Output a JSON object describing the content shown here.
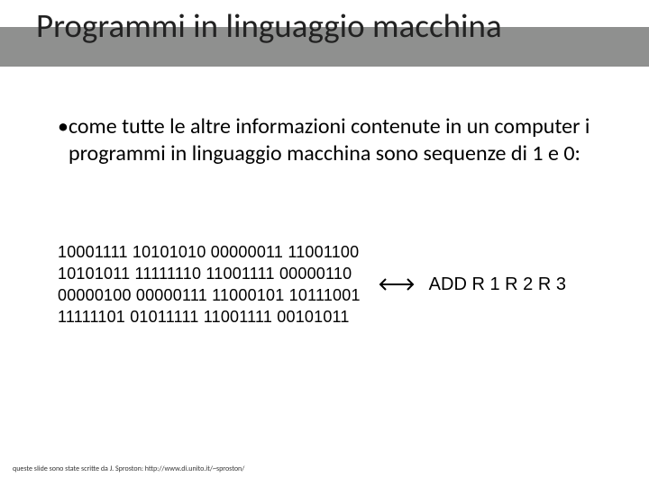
{
  "title": "Programmi in linguaggio macchina",
  "bullet": {
    "marker": "•",
    "text": "come tutte le altre informazioni contenute in un computer i programmi in linguaggio macchina sono sequenze di 1 e 0:"
  },
  "binary": {
    "line1": "10001111 10101010 00000011 11001100",
    "line2": "10101011 11111110 11001111 00000110",
    "line3": "00000100 00000111 11000101 10111001",
    "line4": "11111101 01011111 11001111 00101011"
  },
  "mnemonic": "ADD R 1 R 2 R 3",
  "footer": "queste slide sono state scritte da J. Sproston: http://www.di.unito.it/~sproston/"
}
